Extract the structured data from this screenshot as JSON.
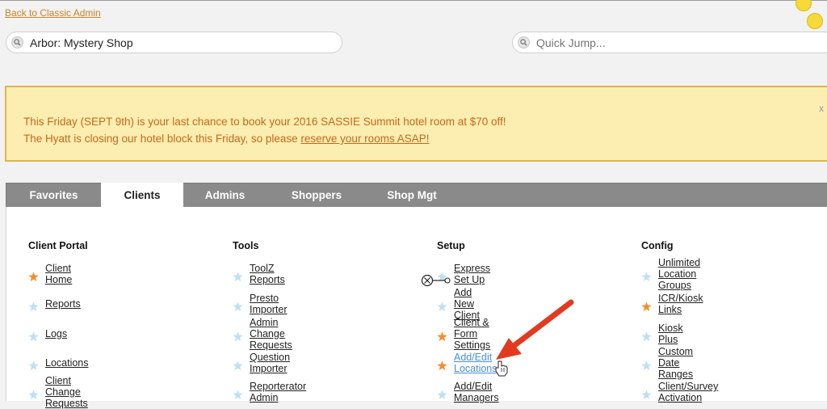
{
  "header": {
    "back_link": "Back to Classic Admin"
  },
  "search": {
    "client_value": "Arbor: Mystery Shop",
    "jump_placeholder": "Quick Jump..."
  },
  "announcement": {
    "line1": "This Friday (SEPT 9th) is your last chance to book your 2016 SASSIE Summit hotel room at $70 off!",
    "line2_prefix": "The Hyatt is closing our hotel block this Friday, so please ",
    "line2_link": "reserve your rooms ASAP!"
  },
  "tabs": [
    {
      "label": "Favorites"
    },
    {
      "label": "Clients"
    },
    {
      "label": "Admins"
    },
    {
      "label": "Shoppers"
    },
    {
      "label": "Shop Mgt"
    }
  ],
  "columns": [
    {
      "title": "Client Portal",
      "items": [
        {
          "label": "Client Home",
          "star": "orange"
        },
        {
          "label": "Reports",
          "star": "blue"
        },
        {
          "label": "Logs",
          "star": "blue"
        },
        {
          "label": "Locations",
          "star": "blue"
        },
        {
          "label": "Client Change Requests",
          "star": "blue"
        }
      ]
    },
    {
      "title": "Tools",
      "items": [
        {
          "label": "ToolZ Reports",
          "star": "blue"
        },
        {
          "label": "Presto Importer",
          "star": "blue"
        },
        {
          "label": "Admin Change Requests",
          "star": "blue"
        },
        {
          "label": "Question Importer",
          "star": "blue"
        },
        {
          "label": "Reporterator Admin",
          "star": "blue"
        }
      ]
    },
    {
      "title": "Setup",
      "items": [
        {
          "label": "Express Set Up",
          "star": "blue"
        },
        {
          "label": "Add New Client",
          "star": "blue"
        },
        {
          "label": "Client & Form Settings",
          "star": "orange"
        },
        {
          "label": "Add/Edit Locations",
          "star": "orange",
          "active": true
        },
        {
          "label": "Add/Edit Managers",
          "star": "blue"
        }
      ]
    },
    {
      "title": "Config",
      "items": [
        {
          "label": "Unlimited Location Groups",
          "star": "blue"
        },
        {
          "label": "ICR/Kiosk Links",
          "star": "orange"
        },
        {
          "label": "Kiosk Plus",
          "star": "blue"
        },
        {
          "label": "Custom Date Ranges",
          "star": "blue"
        },
        {
          "label": "Client/Survey Activation",
          "star": "blue"
        }
      ]
    }
  ],
  "colors": {
    "star_orange": "#f0902e",
    "star_blue": "#bfe0f2",
    "arrow": "#e23a1f",
    "accent_link": "#4a8fd6"
  },
  "icons": [
    "search-icon",
    "star-icon",
    "close-icon",
    "arrow-annotation-icon",
    "hand-cursor-icon"
  ]
}
